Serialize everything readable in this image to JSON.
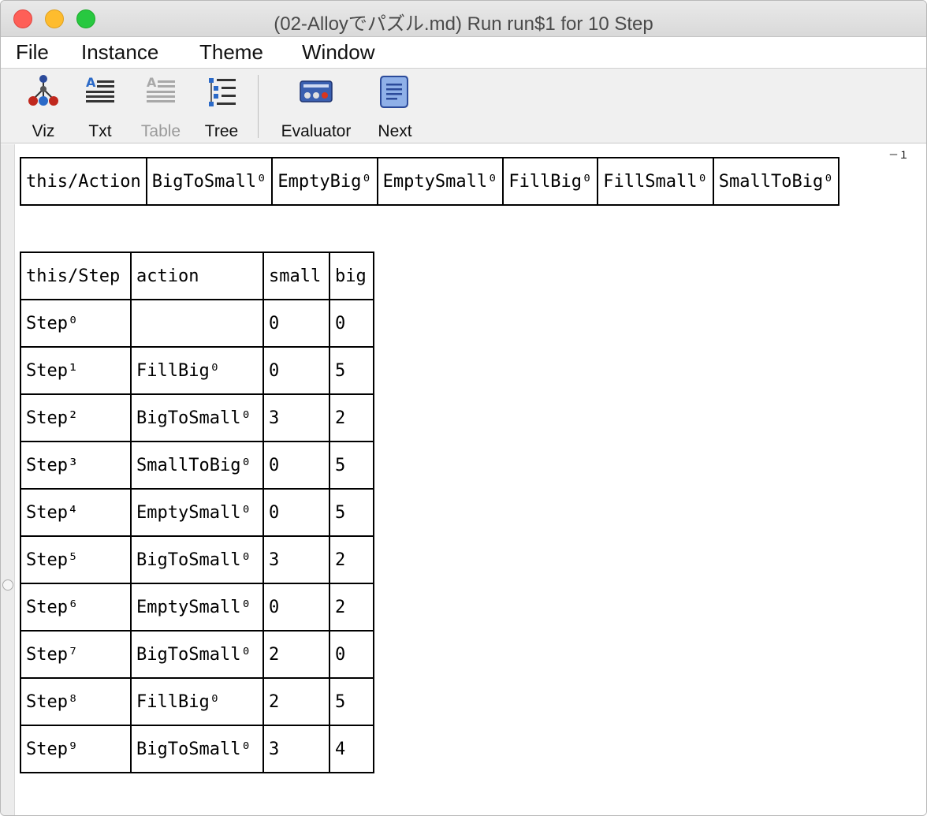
{
  "window": {
    "title": "(02-Alloyでパズル.md) Run run$1 for 10 Step"
  },
  "menu": [
    "File",
    "Instance",
    "Theme",
    "Window"
  ],
  "toolbar": {
    "viz": "Viz",
    "txt": "Txt",
    "table": "Table",
    "tree": "Tree",
    "evaluator": "Evaluator",
    "next": "Next"
  },
  "corner_label": "－１",
  "action_table": {
    "cells": [
      "this/Action",
      "BigToSmall⁰",
      "EmptyBig⁰",
      "EmptySmall⁰",
      "FillBig⁰",
      "FillSmall⁰",
      "SmallToBig⁰"
    ]
  },
  "step_table": {
    "headers": [
      "this/Step",
      "action",
      "small",
      "big"
    ],
    "rows": [
      [
        "Step⁰",
        "",
        "0",
        "0"
      ],
      [
        "Step¹",
        "FillBig⁰",
        "0",
        "5"
      ],
      [
        "Step²",
        "BigToSmall⁰",
        "3",
        "2"
      ],
      [
        "Step³",
        "SmallToBig⁰",
        "0",
        "5"
      ],
      [
        "Step⁴",
        "EmptySmall⁰",
        "0",
        "5"
      ],
      [
        "Step⁵",
        "BigToSmall⁰",
        "3",
        "2"
      ],
      [
        "Step⁶",
        "EmptySmall⁰",
        "0",
        "2"
      ],
      [
        "Step⁷",
        "BigToSmall⁰",
        "2",
        "0"
      ],
      [
        "Step⁸",
        "FillBig⁰",
        "2",
        "5"
      ],
      [
        "Step⁹",
        "BigToSmall⁰",
        "3",
        "4"
      ]
    ]
  }
}
